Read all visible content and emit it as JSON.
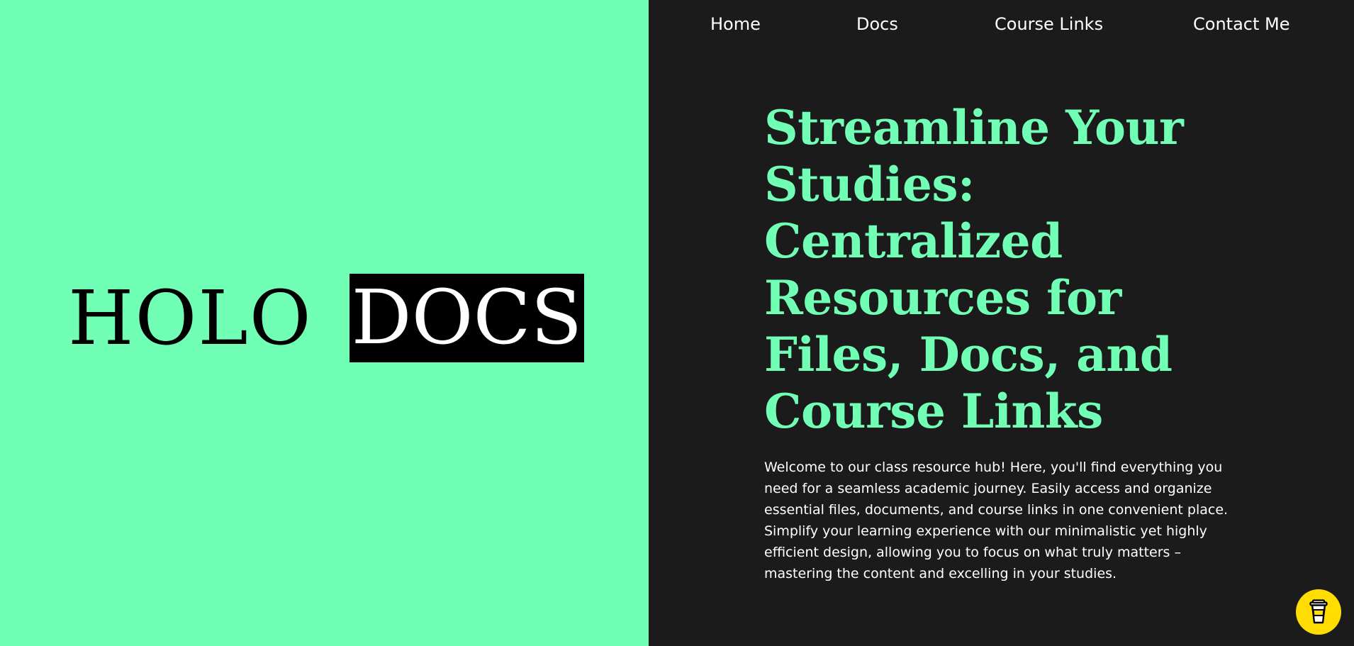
{
  "logo": {
    "part1": "HOLO",
    "part2": "DOCS"
  },
  "nav": {
    "items": [
      {
        "label": "Home"
      },
      {
        "label": "Docs"
      },
      {
        "label": "Course Links"
      },
      {
        "label": "Contact Me"
      }
    ]
  },
  "hero": {
    "headline": "Streamline Your Studies: Centralized Resources for Files, Docs, and Course Links",
    "body": "Welcome to our class resource hub! Here, you'll find everything you need for a seamless academic journey. Easily access and organize essential files, documents, and course links in one convenient place. Simplify your learning experience with our minimalistic yet highly efficient design, allowing you to focus on what truly matters – mastering the content and excelling in your studies."
  },
  "floating_button": {
    "icon": "coffee-cup-icon"
  },
  "colors": {
    "accent_green": "#70ffb5",
    "dark_background": "#1b1b1b",
    "button_yellow": "#ffdd00"
  }
}
